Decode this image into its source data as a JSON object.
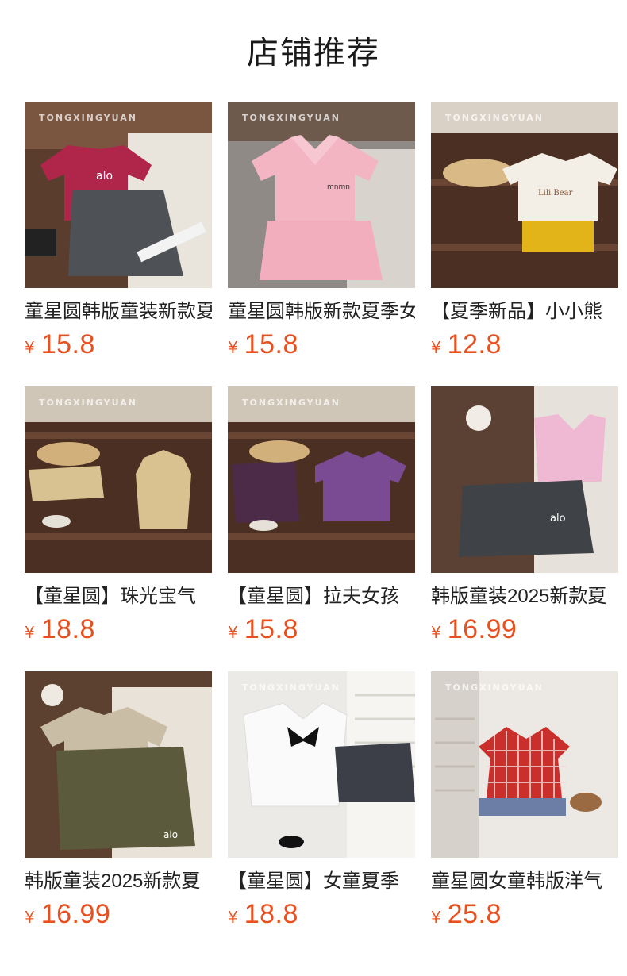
{
  "header": {
    "title": "店铺推荐"
  },
  "currency_symbol": "¥",
  "watermark": "TONGXINGYUAN",
  "colors": {
    "price": "#e8501f",
    "title": "#222222"
  },
  "products": [
    {
      "title": "童星圆韩版童装新款夏季",
      "price": "15.8",
      "image": "product-photo-maroon-tshirt-grey-skirt"
    },
    {
      "title": "童星圆韩版新款夏季女",
      "price": "15.8",
      "image": "product-photo-pink-polo-set"
    },
    {
      "title": "【夏季新品】小小熊",
      "price": "12.8",
      "image": "product-photo-white-bear-tee-yellow-shorts"
    },
    {
      "title": "【童星圆】珠光宝气",
      "price": "18.8",
      "image": "product-photo-gold-sleeveless-set"
    },
    {
      "title": "【童星圆】拉夫女孩",
      "price": "15.8",
      "image": "product-photo-purple-tee-set"
    },
    {
      "title": "韩版童装2025新款夏",
      "price": "16.99",
      "image": "product-photo-pink-vest-black-skirt"
    },
    {
      "title": "韩版童装2025新款夏",
      "price": "16.99",
      "image": "product-photo-beige-tee-olive-skirt"
    },
    {
      "title": "【童星圆】女童夏季",
      "price": "18.8",
      "image": "product-photo-white-sailor-top-navy-skirt"
    },
    {
      "title": "童星圆女童韩版洋气",
      "price": "25.8",
      "image": "product-photo-red-gingham-dress"
    }
  ]
}
